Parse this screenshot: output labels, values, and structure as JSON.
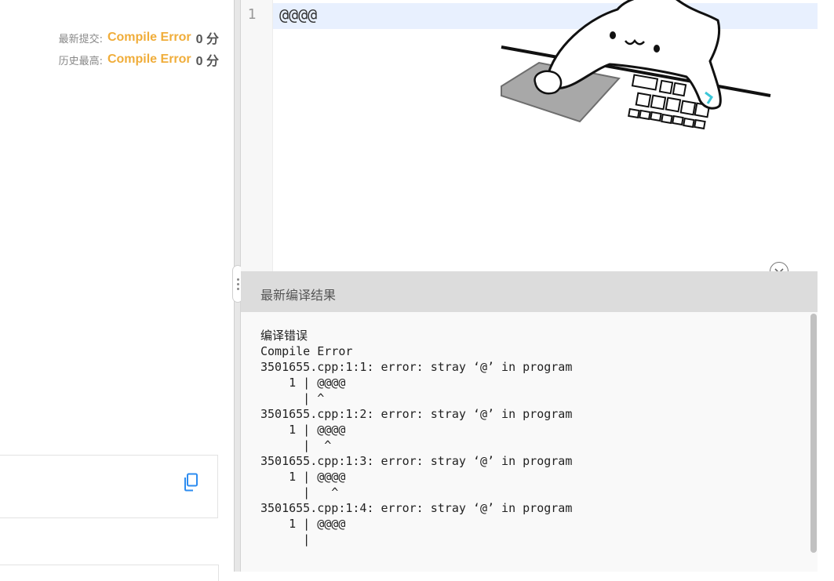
{
  "status": {
    "latest": {
      "label": "最新提交:",
      "result": "Compile Error",
      "score": "0 分"
    },
    "best": {
      "label": "历史最高:",
      "result": "Compile Error",
      "score": "0 分"
    }
  },
  "editor": {
    "line_number": "1",
    "code": "@@@@"
  },
  "result": {
    "title": "最新编译结果",
    "output": "编译错误\nCompile Error\n3501655.cpp:1:1: error: stray ‘@’ in program\n    1 | @@@@\n      | ^\n3501655.cpp:1:2: error: stray ‘@’ in program\n    1 | @@@@\n      |  ^\n3501655.cpp:1:3: error: stray ‘@’ in program\n    1 | @@@@\n      |   ^\n3501655.cpp:1:4: error: stray ‘@’ in program\n    1 | @@@@\n      |"
  },
  "colors": {
    "accent": "#f0ad3a",
    "copy_icon": "#2d8cf0",
    "line_highlight": "#e8f0fe"
  },
  "icons": {
    "copy": "copy-icon",
    "collapse": "chevron-down-icon",
    "splitter": "drag-handle-icon"
  }
}
